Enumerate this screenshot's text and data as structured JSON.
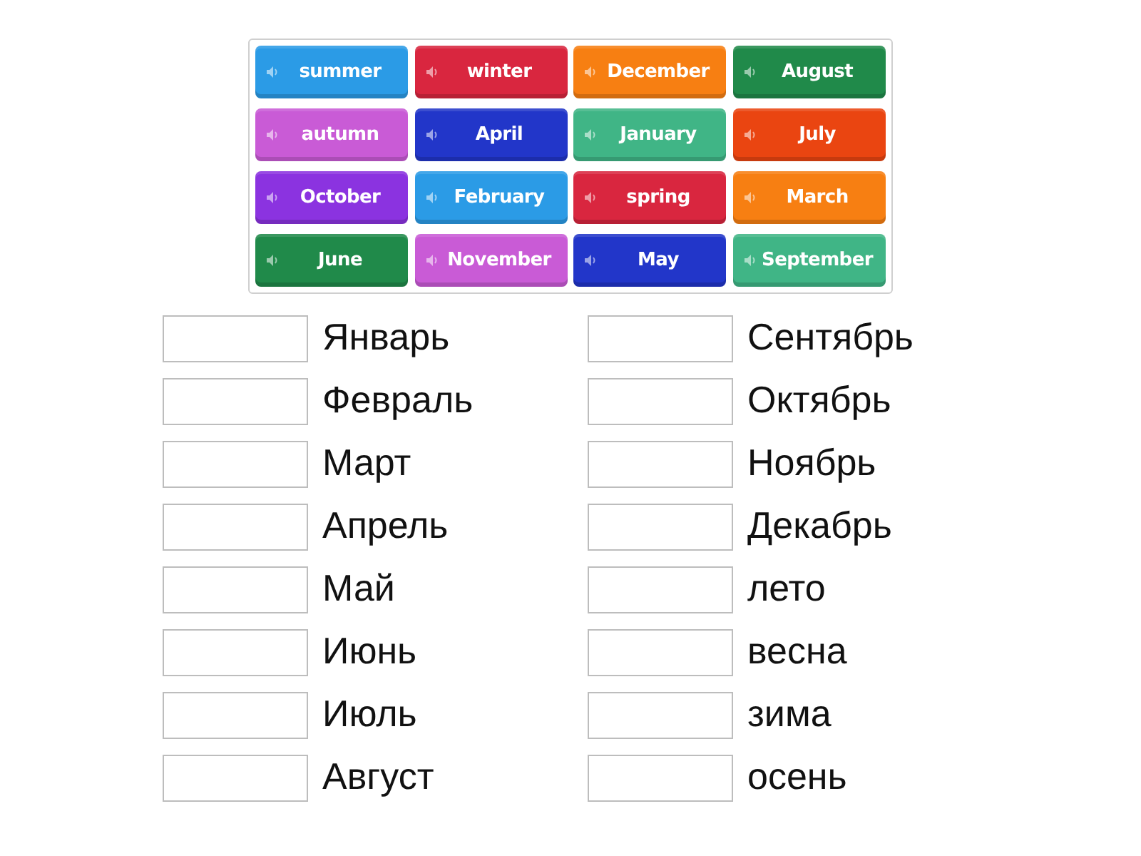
{
  "tiles": [
    {
      "label": "summer",
      "color": "#2b9be6"
    },
    {
      "label": "winter",
      "color": "#d9263f"
    },
    {
      "label": "December",
      "color": "#f77f12"
    },
    {
      "label": "August",
      "color": "#208a4a"
    },
    {
      "label": "autumn",
      "color": "#c95bd6"
    },
    {
      "label": "April",
      "color": "#2236c9"
    },
    {
      "label": "January",
      "color": "#40b586"
    },
    {
      "label": "July",
      "color": "#ea4511"
    },
    {
      "label": "October",
      "color": "#8b33e0"
    },
    {
      "label": "February",
      "color": "#2b9be6"
    },
    {
      "label": "spring",
      "color": "#d9263f"
    },
    {
      "label": "March",
      "color": "#f77f12"
    },
    {
      "label": "June",
      "color": "#208a4a"
    },
    {
      "label": "November",
      "color": "#c95bd6"
    },
    {
      "label": "May",
      "color": "#2236c9"
    },
    {
      "label": "September",
      "color": "#40b586"
    }
  ],
  "answer_columns": [
    {
      "items": [
        "Январь",
        "Февраль",
        "Март",
        "Апрель",
        "Май",
        "Июнь",
        "Июль",
        "Август"
      ]
    },
    {
      "items": [
        "Сентябрь",
        "Октябрь",
        "Ноябрь",
        "Декабрь",
        "лето",
        "весна",
        "зима",
        "осень"
      ]
    }
  ]
}
